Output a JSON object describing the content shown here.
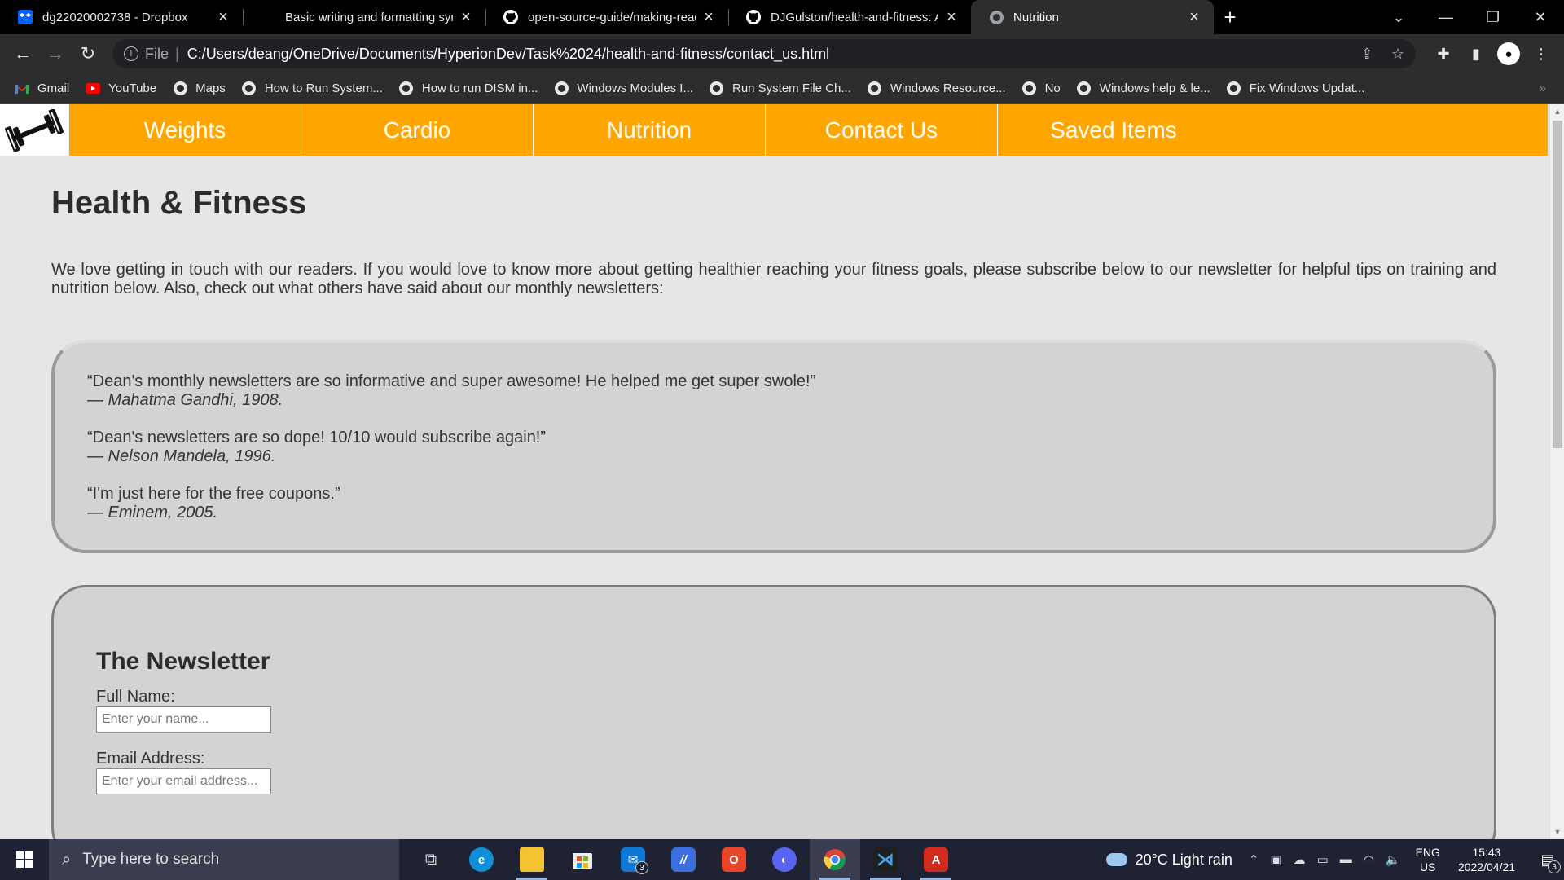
{
  "browser": {
    "tabs": [
      {
        "title": "dg22020002738 - Dropbox",
        "icon": "dropbox-icon"
      },
      {
        "title": "Basic writing and formatting synt",
        "icon": "github-icon"
      },
      {
        "title": "open-source-guide/making-read",
        "icon": "github-icon"
      },
      {
        "title": "DJGulston/health-and-fitness: A v",
        "icon": "github-icon"
      },
      {
        "title": "Nutrition",
        "icon": "globe-icon",
        "active": true
      }
    ],
    "address": {
      "scheme": "File",
      "url": "C:/Users/deang/OneDrive/Documents/HyperionDev/Task%2024/health-and-fitness/contact_us.html"
    },
    "bookmarks": [
      {
        "label": "Gmail",
        "icon": "gmail-icon"
      },
      {
        "label": "YouTube",
        "icon": "youtube-icon"
      },
      {
        "label": "Maps",
        "icon": "globe-icon"
      },
      {
        "label": "How to Run System...",
        "icon": "globe-icon"
      },
      {
        "label": "How to run DISM in...",
        "icon": "globe-icon"
      },
      {
        "label": "Windows Modules I...",
        "icon": "globe-icon"
      },
      {
        "label": "Run System File Ch...",
        "icon": "globe-icon"
      },
      {
        "label": "Windows Resource...",
        "icon": "globe-icon"
      },
      {
        "label": "No",
        "icon": "globe-icon"
      },
      {
        "label": "Windows help & le...",
        "icon": "globe-icon"
      },
      {
        "label": "Fix Windows Updat...",
        "icon": "globe-icon"
      }
    ],
    "more_bookmarks": "»"
  },
  "site": {
    "nav": [
      "Weights",
      "Cardio",
      "Nutrition",
      "Contact Us",
      "Saved Items"
    ],
    "title": "Health & Fitness",
    "intro": "We love getting in touch with our readers. If you would love to know more about getting healthier reaching your fitness goals, please subscribe below to our newsletter for helpful tips on training and nutrition below. Also, check out what others have said about our monthly newsletters:",
    "quotes": [
      {
        "text": "“Dean's monthly newsletters are so informative and super awesome! He helped me get super swole!”",
        "author": "— Mahatma Gandhi, 1908."
      },
      {
        "text": "“Dean's newsletters are so dope! 10/10 would subscribe again!”",
        "author": "— Nelson Mandela, 1996."
      },
      {
        "text": "“I'm just here for the free coupons.”",
        "author": "— Eminem, 2005."
      }
    ],
    "newsletter": {
      "heading": "The Newsletter",
      "name_label": "Full Name:",
      "name_placeholder": "Enter your name...",
      "email_label": "Email Address:",
      "email_placeholder": "Enter your email address..."
    }
  },
  "taskbar": {
    "search_placeholder": "Type here to search",
    "mail_badge": "3",
    "weather": "20°C  Light rain",
    "lang_top": "ENG",
    "lang_bottom": "US",
    "time": "15:43",
    "date": "2022/04/21",
    "notification_count": "3"
  },
  "colors": {
    "nav_bg": "#ffa500",
    "page_bg": "#e6e6e6",
    "card_bg": "#d3d3d3"
  }
}
